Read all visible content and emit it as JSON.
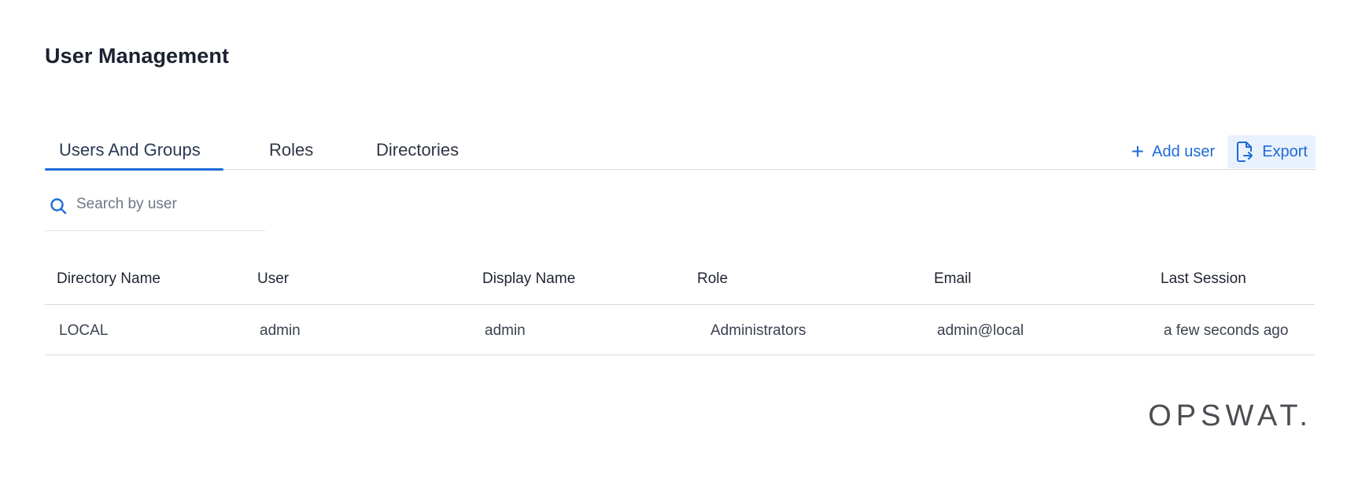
{
  "page": {
    "title": "User Management"
  },
  "tabs": [
    {
      "label": "Users And Groups",
      "active": true
    },
    {
      "label": "Roles",
      "active": false
    },
    {
      "label": "Directories",
      "active": false
    }
  ],
  "actions": {
    "add_user_label": "Add user",
    "export_label": "Export"
  },
  "search": {
    "placeholder": "Search by user",
    "value": ""
  },
  "table": {
    "columns": [
      "Directory Name",
      "User",
      "Display Name",
      "Role",
      "Email",
      "Last Session"
    ],
    "rows": [
      [
        "LOCAL",
        "admin",
        "admin",
        "Administrators",
        "admin@local",
        "a few seconds ago"
      ]
    ]
  },
  "brand": {
    "logo_text": "OPSWAT.",
    "accent_color": "#1d6bd8"
  }
}
